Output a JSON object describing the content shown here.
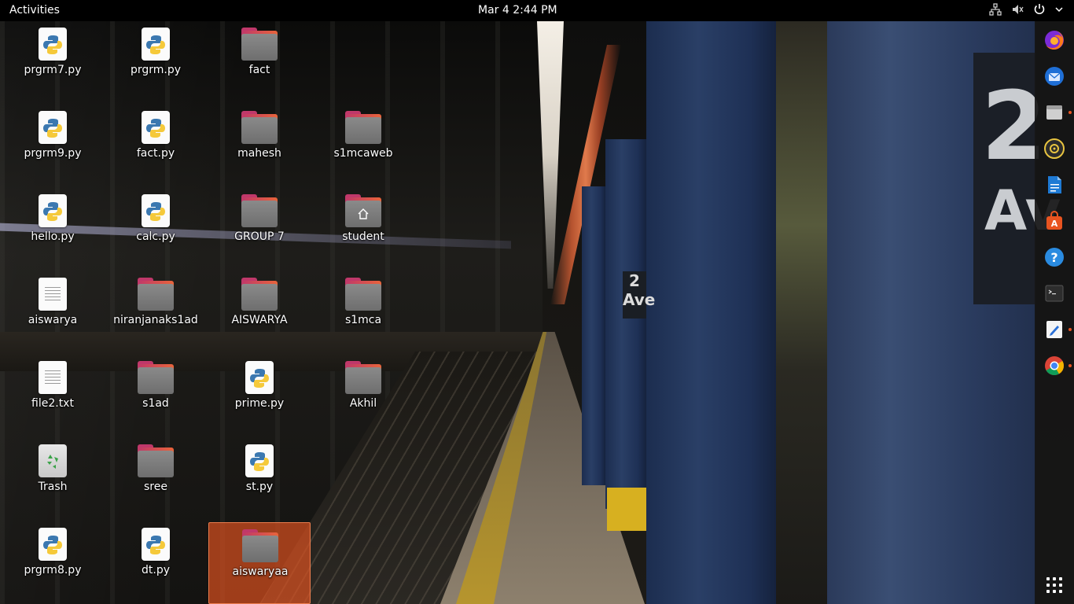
{
  "topbar": {
    "activities": "Activities",
    "clock": "Mar 4  2:44 PM"
  },
  "tray_icons": [
    "network-icon",
    "volume-icon",
    "power-icon"
  ],
  "wallpaper": {
    "sign_number": "2",
    "sign_ave": "Av",
    "small_sign": "2\nAve"
  },
  "dock": {
    "items": [
      {
        "name": "firefox",
        "running": false
      },
      {
        "name": "thunderbird",
        "running": false
      },
      {
        "name": "files",
        "running": true
      },
      {
        "name": "rhythmbox",
        "running": false
      },
      {
        "name": "libreoffice-writer",
        "running": false
      },
      {
        "name": "software-center",
        "running": false
      },
      {
        "name": "help",
        "running": false
      },
      {
        "name": "terminal",
        "running": false
      },
      {
        "name": "text-editor",
        "running": true
      },
      {
        "name": "chrome",
        "running": true
      }
    ]
  },
  "desktop": {
    "icons": [
      {
        "label": "prgrm7.py",
        "type": "python"
      },
      {
        "label": "prgrm.py",
        "type": "python"
      },
      {
        "label": "fact",
        "type": "folder"
      },
      {
        "label": "prgrm9.py",
        "type": "python"
      },
      {
        "label": "fact.py",
        "type": "python"
      },
      {
        "label": "mahesh",
        "type": "folder"
      },
      {
        "label": "s1mcaweb",
        "type": "folder"
      },
      {
        "label": "hello.py",
        "type": "python"
      },
      {
        "label": "calc.py",
        "type": "python"
      },
      {
        "label": "GROUP 7",
        "type": "folder"
      },
      {
        "label": "student",
        "type": "home-folder"
      },
      {
        "label": "aiswarya",
        "type": "text"
      },
      {
        "label": "niranjanaks1ad",
        "type": "folder"
      },
      {
        "label": "AISWARYA",
        "type": "folder"
      },
      {
        "label": "s1mca",
        "type": "folder"
      },
      {
        "label": "file2.txt",
        "type": "text"
      },
      {
        "label": "s1ad",
        "type": "folder"
      },
      {
        "label": "prime.py",
        "type": "python"
      },
      {
        "label": "Akhil",
        "type": "folder"
      },
      {
        "label": "Trash",
        "type": "trash"
      },
      {
        "label": "sree",
        "type": "folder"
      },
      {
        "label": "st.py",
        "type": "python"
      },
      {
        "label": "prgrm8.py",
        "type": "python"
      },
      {
        "label": "dt.py",
        "type": "python"
      },
      {
        "label": "aiswaryaa",
        "type": "folder",
        "selected": true
      }
    ]
  }
}
